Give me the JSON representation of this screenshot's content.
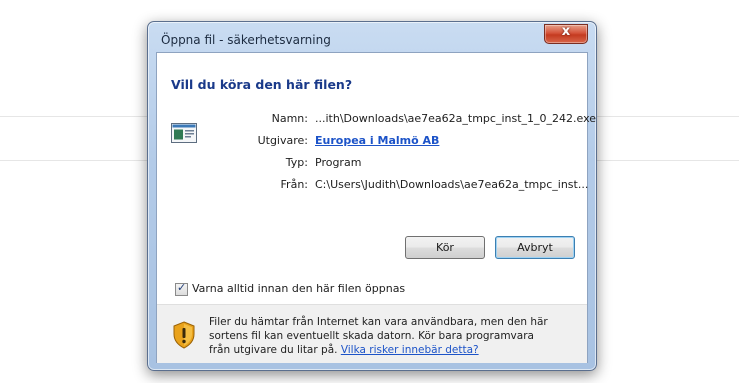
{
  "dialog": {
    "title": "Öppna fil - säkerhetsvarning",
    "close_glyph": "x",
    "heading": "Vill du köra den här filen?",
    "info": {
      "name_label": "Namn:",
      "name_value": "...ith\\Downloads\\ae7ea62a_tmpc_inst_1_0_242.exe",
      "publisher_label": "Utgivare:",
      "publisher_value": "Europea i Malmö AB",
      "type_label": "Typ:",
      "type_value": "Program",
      "from_label": "Från:",
      "from_value": "C:\\Users\\Judith\\Downloads\\ae7ea62a_tmpc_inst..."
    },
    "buttons": {
      "run": "Kör",
      "cancel": "Avbryt"
    },
    "checkbox": {
      "label": "Varna alltid innan den här filen öppnas",
      "checked": true,
      "check_glyph": "✓"
    },
    "footer": {
      "text_part1": "Filer du hämtar från Internet kan vara användbara, men den här sortens fil kan eventuellt skada datorn. Kör bara programvara från utgivare du litar på. ",
      "link": "Vilka risker innebär detta?"
    }
  },
  "colors": {
    "heading": "#1a3a8a",
    "link": "#1c53c8",
    "close_button": "#c43a20"
  },
  "icons": {
    "file": "application-window-icon",
    "warning": "security-shield-icon"
  }
}
